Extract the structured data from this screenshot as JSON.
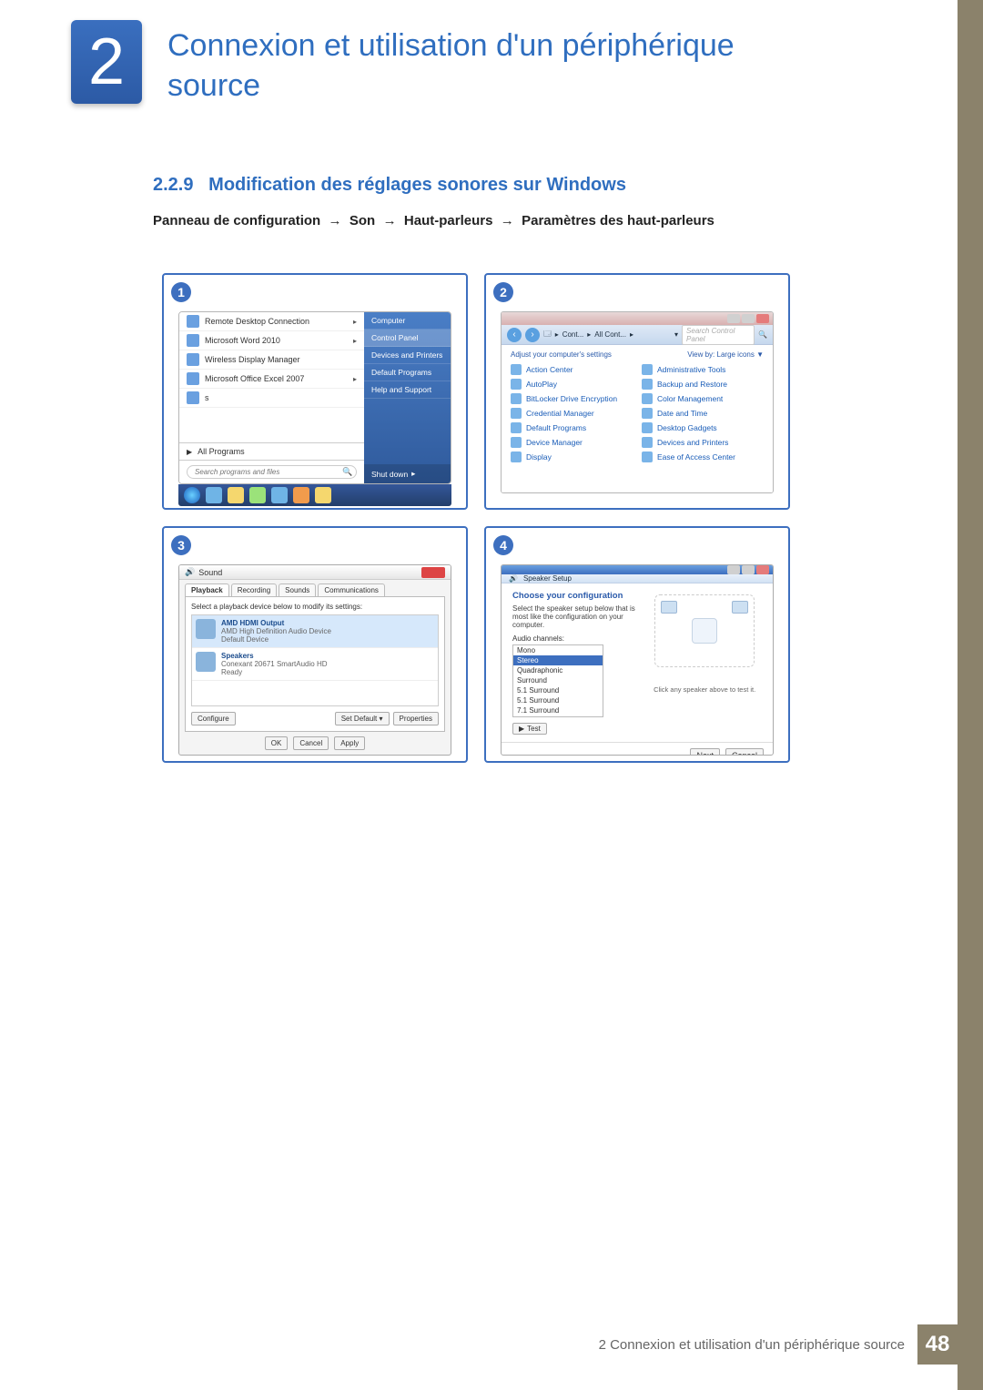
{
  "chapter": {
    "number": "2",
    "title": "Connexion et utilisation d'un périphérique source"
  },
  "section": {
    "number": "2.2.9",
    "title": "Modification des réglages sonores sur Windows"
  },
  "breadcrumb": {
    "p1": "Panneau de configuration",
    "p2": "Son",
    "p3": "Haut-parleurs",
    "p4": "Paramètres des haut-parleurs",
    "arrow": "→"
  },
  "shot1": {
    "badge": "1",
    "left_items": [
      "Remote Desktop Connection",
      "Microsoft Word 2010",
      "Wireless Display Manager",
      "Microsoft Office Excel 2007",
      "s"
    ],
    "all_programs": "All Programs",
    "search_placeholder": "Search programs and files",
    "right_items": [
      "Computer",
      "Control Panel",
      "Devices and Printers",
      "Default Programs",
      "Help and Support"
    ],
    "shutdown": "Shut down"
  },
  "shot2": {
    "badge": "2",
    "addr1": "Cont...",
    "addr2": "All Cont...",
    "search_placeholder": "Search Control Panel",
    "adjust": "Adjust your computer's settings",
    "viewby": "View by:   Large icons ▼",
    "items_left": [
      "Action Center",
      "AutoPlay",
      "BitLocker Drive Encryption",
      "Credential Manager",
      "Default Programs",
      "Device Manager",
      "Display"
    ],
    "items_right": [
      "Administrative Tools",
      "Backup and Restore",
      "Color Management",
      "Date and Time",
      "Desktop Gadgets",
      "Devices and Printers",
      "Ease of Access Center"
    ]
  },
  "shot3": {
    "badge": "3",
    "title": "Sound",
    "tabs": [
      "Playback",
      "Recording",
      "Sounds",
      "Communications"
    ],
    "hint": "Select a playback device below to modify its settings:",
    "dev1_name": "AMD HDMI Output",
    "dev1_sub": "AMD High Definition Audio Device\nDefault Device",
    "dev2_name": "Speakers",
    "dev2_sub": "Conexant 20671 SmartAudio HD\nReady",
    "btn_configure": "Configure",
    "btn_setdefault": "Set Default ▾",
    "btn_properties": "Properties",
    "btn_ok": "OK",
    "btn_cancel": "Cancel",
    "btn_apply": "Apply"
  },
  "shot4": {
    "badge": "4",
    "bar": "Speaker Setup",
    "sec_title": "Choose your configuration",
    "hint": "Select the speaker setup below that is most like the configuration on your computer.",
    "audio_label": "Audio channels:",
    "channels": [
      "Mono",
      "Stereo",
      "Quadraphonic",
      "Surround",
      "5.1 Surround",
      "5.1 Surround",
      "7.1 Surround"
    ],
    "test": "Test",
    "note": "Click any speaker above to test it.",
    "btn_next": "Next",
    "btn_cancel": "Cancel"
  },
  "footer": {
    "text": "2 Connexion et utilisation d'un périphérique source",
    "page": "48"
  }
}
